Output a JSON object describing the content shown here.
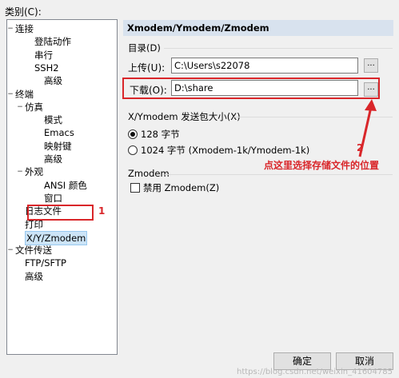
{
  "category_label": "类别(C):",
  "tree": [
    {
      "label": "连接",
      "indent": 0,
      "twisty": "−"
    },
    {
      "label": "登陆动作",
      "indent": 2
    },
    {
      "label": "串行",
      "indent": 2
    },
    {
      "label": "SSH2",
      "indent": 2
    },
    {
      "label": "高级",
      "indent": 3
    },
    {
      "label": "终端",
      "indent": 0,
      "twisty": "−"
    },
    {
      "label": "仿真",
      "indent": 1,
      "twisty": "−"
    },
    {
      "label": "模式",
      "indent": 3
    },
    {
      "label": "Emacs",
      "indent": 3
    },
    {
      "label": "映射键",
      "indent": 3
    },
    {
      "label": "高级",
      "indent": 3
    },
    {
      "label": "外观",
      "indent": 1,
      "twisty": "−"
    },
    {
      "label": "ANSI 颜色",
      "indent": 3
    },
    {
      "label": "窗口",
      "indent": 3
    },
    {
      "label": "日志文件",
      "indent": 1
    },
    {
      "label": "打印",
      "indent": 1
    },
    {
      "label": "X/Y/Zmodem",
      "indent": 1,
      "selected": true
    },
    {
      "label": "文件传送",
      "indent": 0,
      "twisty": "−"
    },
    {
      "label": "FTP/SFTP",
      "indent": 1
    },
    {
      "label": "高级",
      "indent": 1
    }
  ],
  "panel": {
    "header": "Xmodem/Ymodem/Zmodem",
    "dir_group": "目录(D)",
    "upload_label": "上传(U):",
    "upload_value": "C:\\Users\\s22078",
    "download_label": "下载(O):",
    "download_value": "D:\\share",
    "browse": "...",
    "packet_group": "X/Ymodem 发送包大小(X)",
    "packet_opt1": "128 字节",
    "packet_opt2": "1024 字节  (Xmodem-1k/Ymodem-1k)",
    "zmodem_group": "Zmodem",
    "zmodem_disable": "禁用 Zmodem(Z)"
  },
  "annotations": {
    "num1": "1",
    "num2": "2",
    "note2": "点这里选择存储文件的位置"
  },
  "buttons": {
    "ok": "确定",
    "cancel": "取消"
  },
  "watermark": "https://blog.csdn.net/weixin_41604785"
}
